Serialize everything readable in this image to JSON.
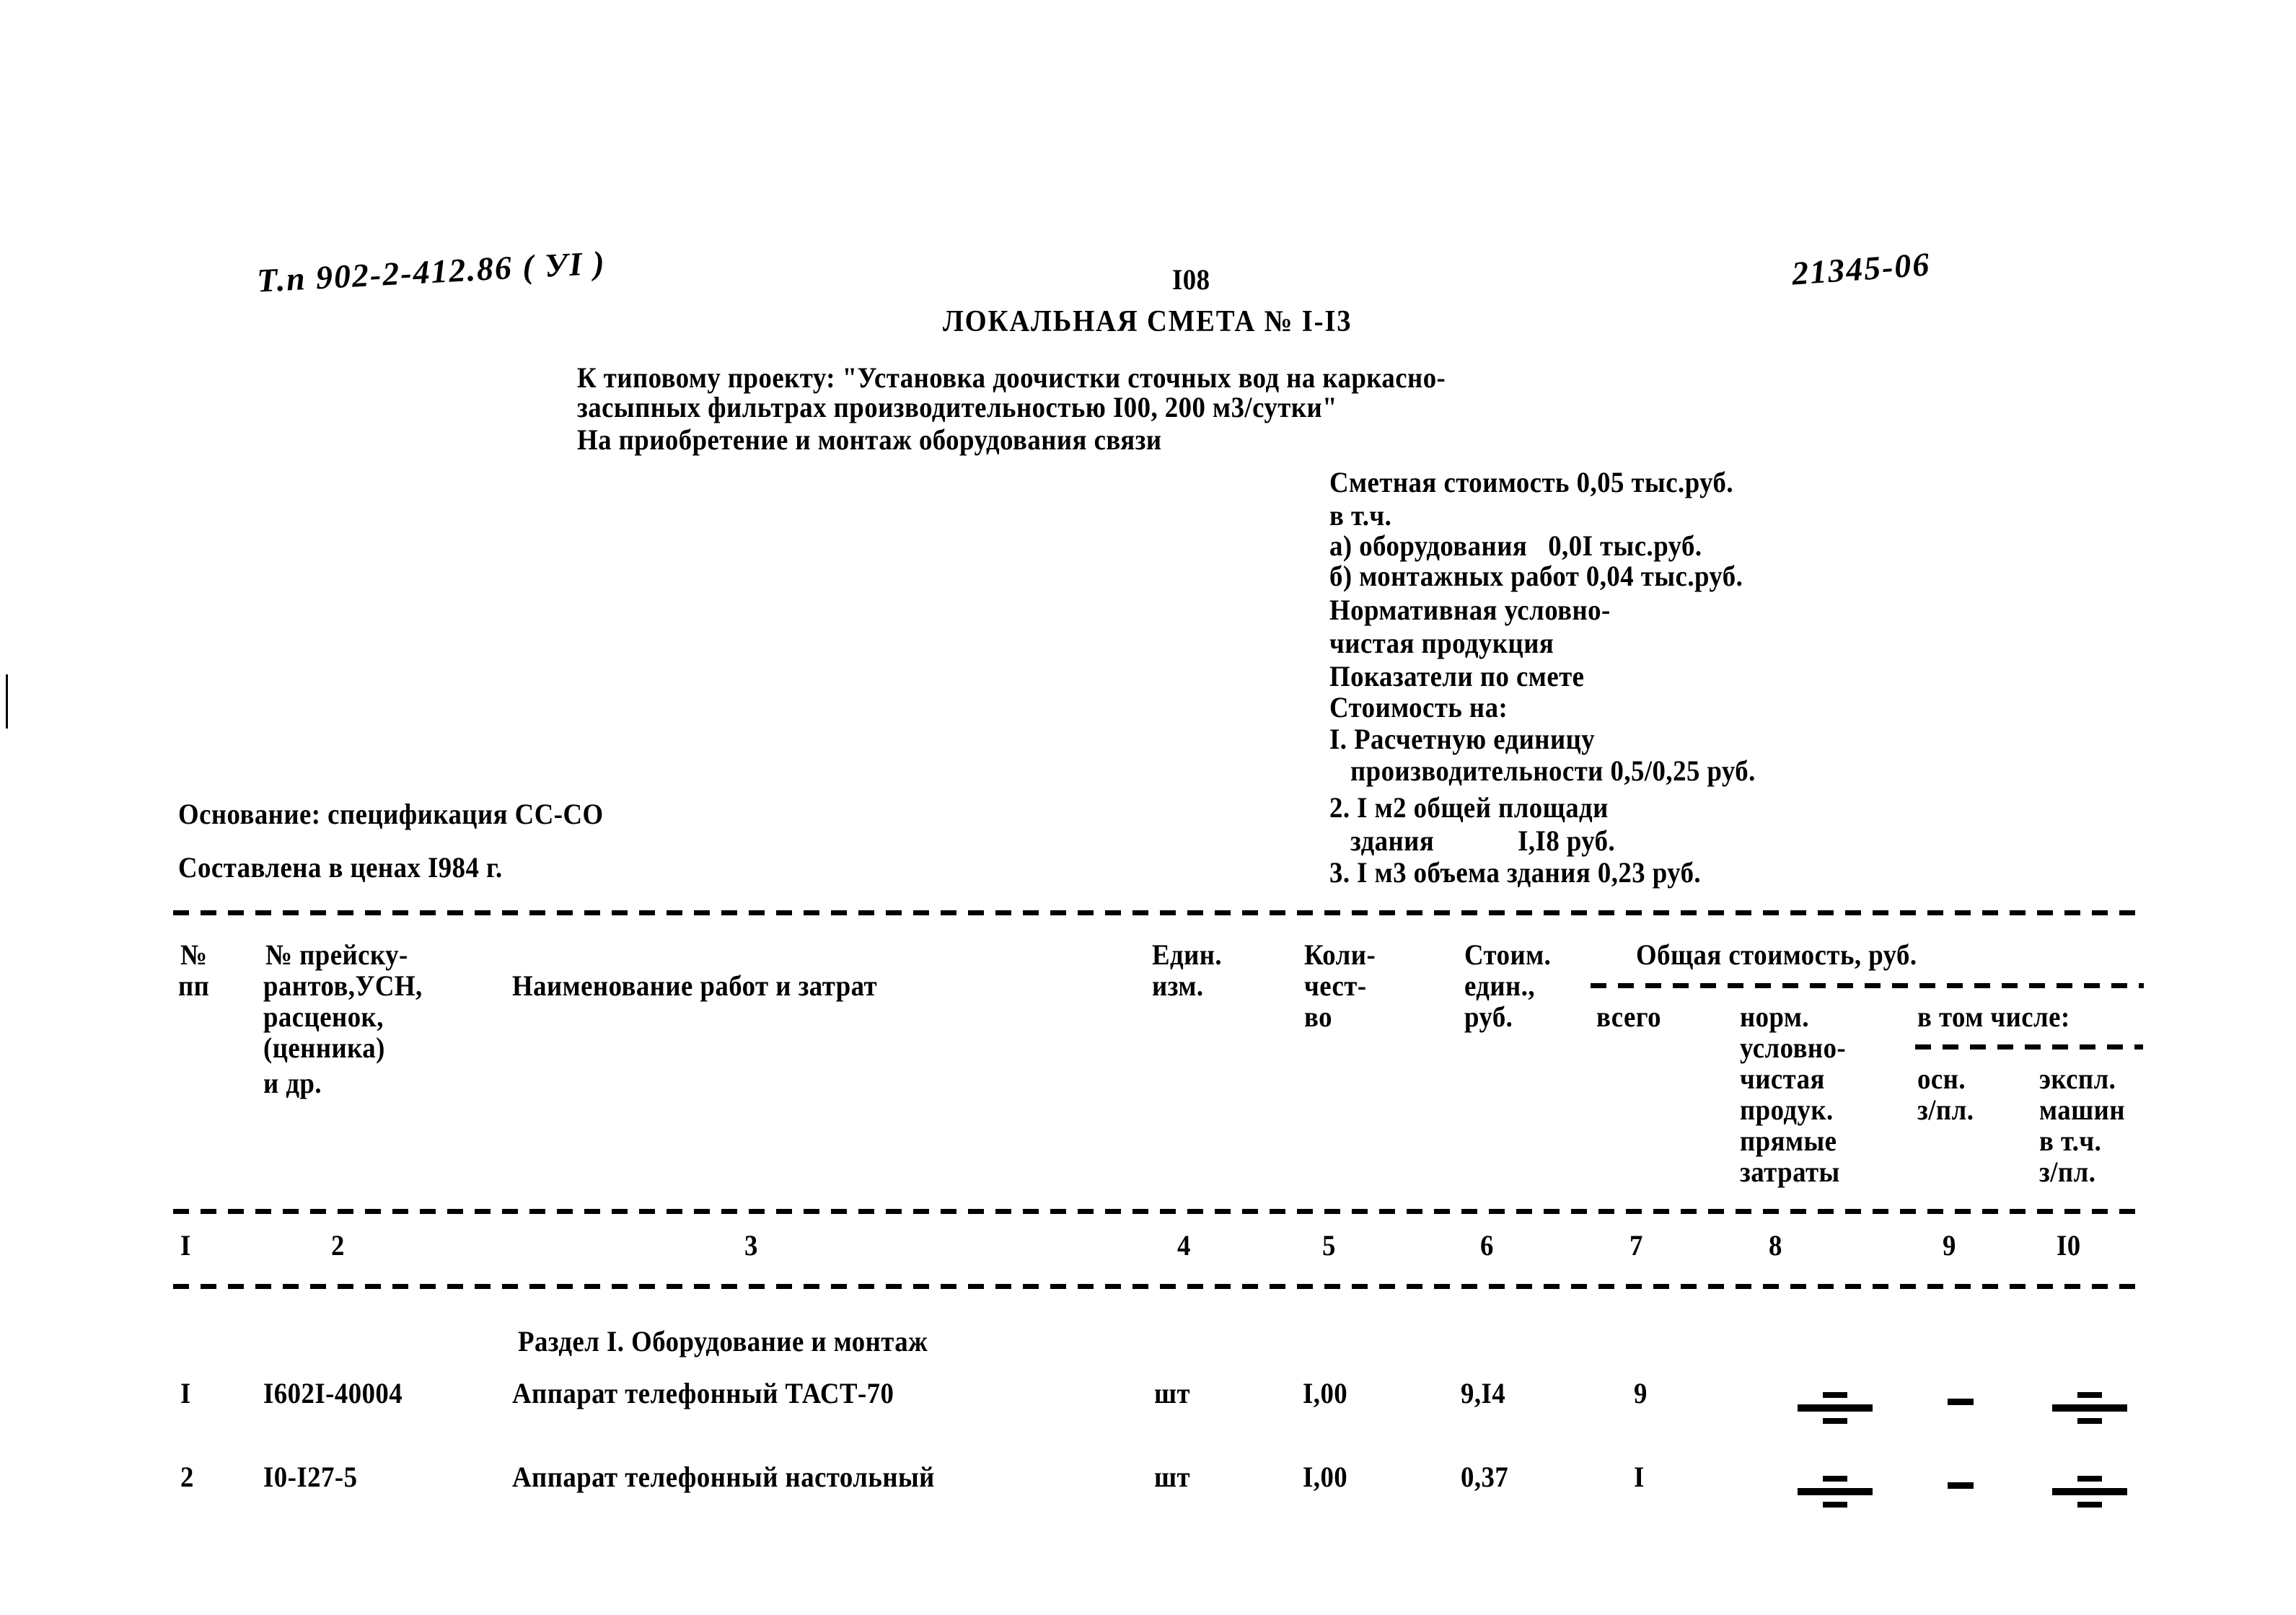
{
  "document": {
    "page_number": "I08",
    "title": "ЛОКАЛЬНАЯ СМЕТА № I-I3",
    "handwritten_left": "Т.п 902-2-412.86 ( УI )",
    "handwritten_right": "21345-06"
  },
  "intro": {
    "line1": "К типовому проекту: \"Установка доочистки сточных вод на каркасно-",
    "line2": "засыпных фильтрах производительностью I00, 200 м3/сутки\"",
    "line3": "На приобретение и монтаж оборудования связи"
  },
  "summary": {
    "lines": [
      "Сметная стоимость 0,05 тыс.руб.",
      "в т.ч.",
      "а) оборудования   0,0I тыс.руб.",
      "б) монтажных работ 0,04 тыс.руб.",
      "Нормативная условно-",
      "чистая продукция",
      "Показатели по смете",
      "Стоимость на:",
      "I. Расчетную единицу",
      "   производительности 0,5/0,25 руб.",
      "2. I м2 общей площади",
      "   здания            I,I8 руб.",
      "3. I м3 объема здания 0,23 руб."
    ]
  },
  "basis": {
    "line1": "Основание: спецификация СС-СО",
    "line2": "Составлена в ценах I984 г."
  },
  "table": {
    "headers": {
      "col1": [
        "№",
        "пп"
      ],
      "col2": [
        "№ прейску-",
        "рантов,УСН,",
        "расценок,",
        "(ценника)",
        "и др."
      ],
      "col3": [
        "Наименование работ и затрат"
      ],
      "col4": [
        "Един.",
        "изм."
      ],
      "col5": [
        "Коли-",
        "чест-",
        "во"
      ],
      "col6": [
        "Стоим.",
        "един.,",
        "руб."
      ],
      "col_group": "Общая стоимость, руб.",
      "col7": [
        "всего"
      ],
      "col8": [
        "норм.",
        "условно-",
        "чистая",
        "продук.",
        "прямые",
        "затраты"
      ],
      "col_in_group": "в том числе:",
      "col9": [
        "осн.",
        "з/пл."
      ],
      "col10": [
        "экспл.",
        "машин",
        "в т.ч.",
        "з/пл."
      ]
    },
    "column_numbers": [
      "I",
      "2",
      "3",
      "4",
      "5",
      "6",
      "7",
      "8",
      "9",
      "I0"
    ],
    "section_title": "Раздел I. Оборудование и монтаж",
    "rows": [
      {
        "num": "I",
        "code": "I602I-40004",
        "name": "Аппарат телефонный ТАСТ-70",
        "unit": "шт",
        "qty": "I,00",
        "unit_cost": "9,I4",
        "total": "9",
        "norm": "mark-equals",
        "osn": "mark-dash",
        "mach": "mark-equals"
      },
      {
        "num": "2",
        "code": "I0-I27-5",
        "name": "Аппарат телефонный настольный",
        "unit": "шт",
        "qty": "I,00",
        "unit_cost": "0,37",
        "total": "I",
        "norm": "mark-equals",
        "osn": "mark-dash",
        "mach": "mark-equals"
      }
    ]
  }
}
